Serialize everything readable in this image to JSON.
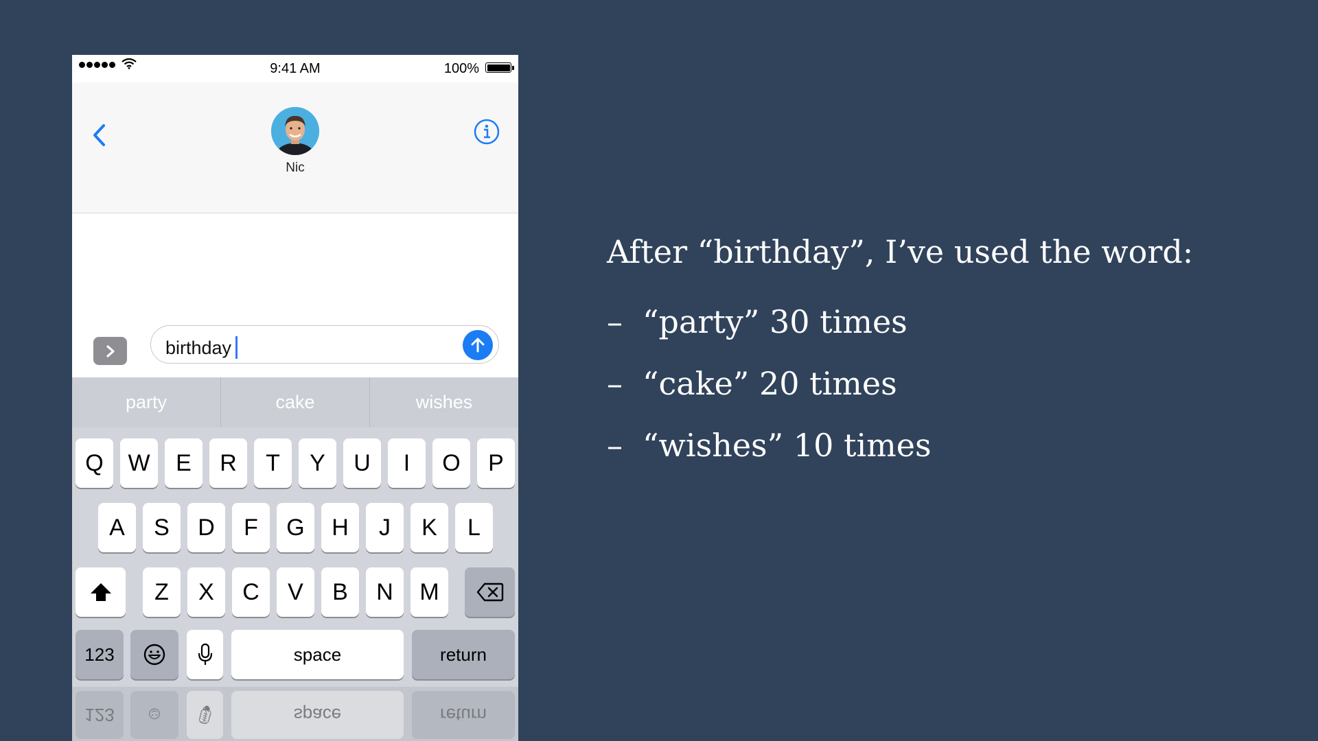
{
  "status_bar": {
    "time": "9:41 AM",
    "battery": "100%"
  },
  "conversation": {
    "contact_name": "Nic"
  },
  "composer": {
    "text": "birthday"
  },
  "predictive": [
    "party",
    "cake",
    "wishes"
  ],
  "keyboard": {
    "row1": [
      "Q",
      "W",
      "E",
      "R",
      "T",
      "Y",
      "U",
      "I",
      "O",
      "P"
    ],
    "row2": [
      "A",
      "S",
      "D",
      "F",
      "G",
      "H",
      "J",
      "K",
      "L"
    ],
    "row3": [
      "Z",
      "X",
      "C",
      "V",
      "B",
      "N",
      "M"
    ],
    "numbers_label": "123",
    "space_label": "space",
    "return_label": "return"
  },
  "slide": {
    "heading": "After “birthday”, I’ve used the word:",
    "items": [
      {
        "dash": "–",
        "text": "“party” 30 times"
      },
      {
        "dash": "–",
        "text": "“cake” 20 times"
      },
      {
        "dash": "–",
        "text": "“wishes” 10 times"
      }
    ]
  },
  "colors": {
    "background": "#31435b",
    "accent": "#1b7cf4"
  }
}
